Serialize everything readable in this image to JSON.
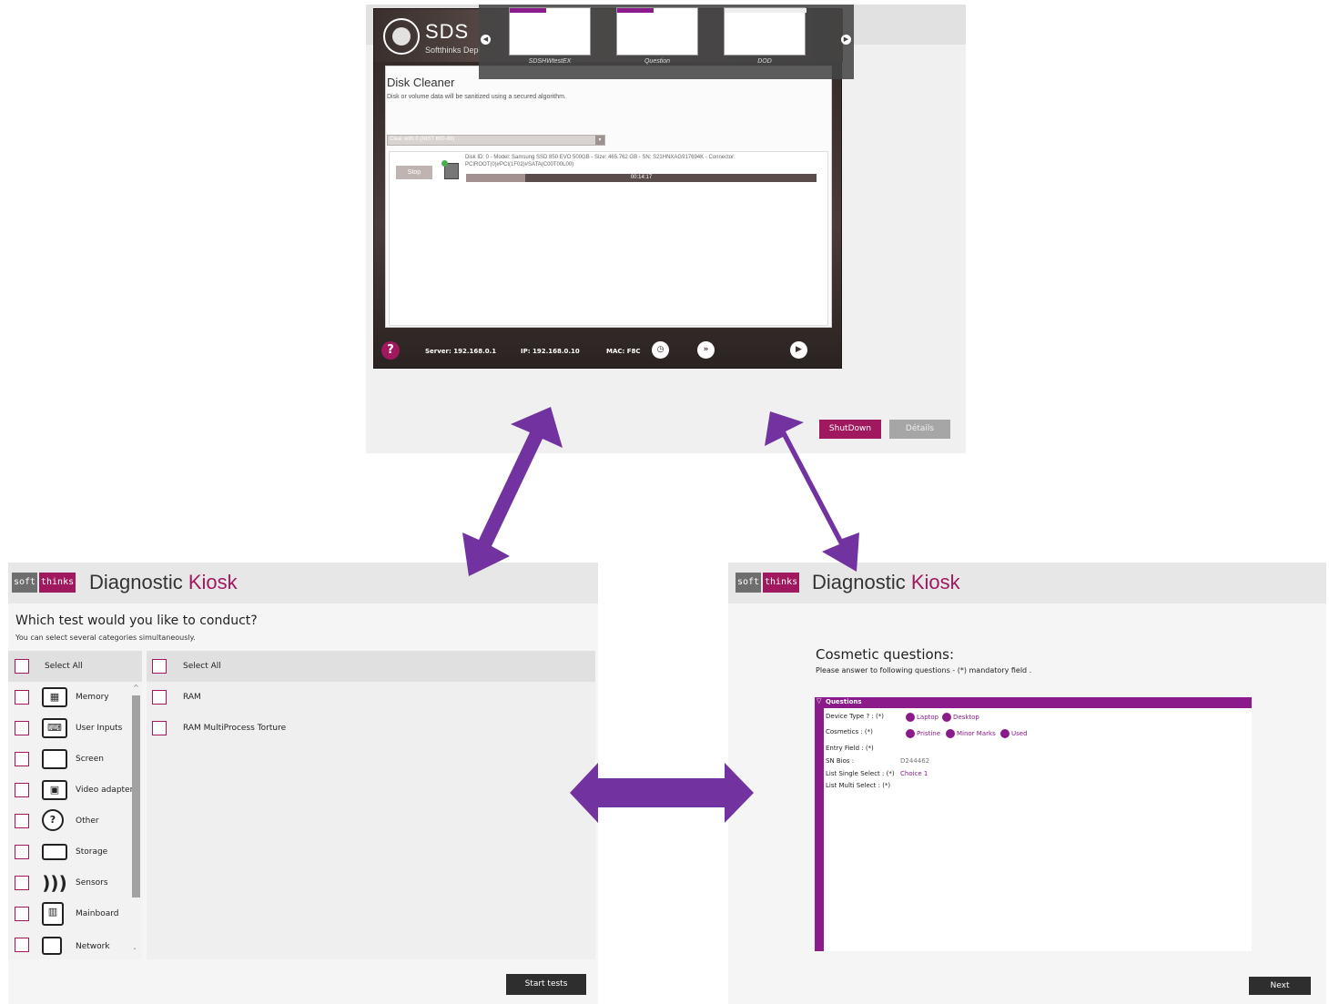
{
  "top_panel": {
    "sds": {
      "title": "SDS",
      "subtitle": "Softthinks Deployment",
      "disk_cleaner_title": "Disk Cleaner",
      "disk_cleaner_subtitle": "Disk or volume data will be sanitized using a secured algorithm.",
      "algorithm_value": "Clear with 0 (NIST 800-88)",
      "stop_label": "Stop",
      "disk_info": "Disk ID: 0 - Model: Samsung SSD 850 EVO 500GB - Size: 465.762 GB - SN: S21HNXAG917694K - Connector: PCIROOT(0)#PCI(1F02)#SATA(C00T00L00)",
      "progress_fraction": 0.17,
      "progress_text": "00:14:17",
      "help_label": "?",
      "server": "Server: 192.168.0.1",
      "ip": "IP: 192.168.0.10",
      "mac": "MAC: F8C"
    },
    "carousel": {
      "items": [
        {
          "label": "SDSHWtestEX"
        },
        {
          "label": "Question"
        },
        {
          "label": "DOD"
        }
      ]
    },
    "buttons": {
      "shutdown": "ShutDown",
      "details": "Détails"
    }
  },
  "left_kiosk": {
    "logo_soft": "soft",
    "logo_thinks": "thinks",
    "title_main": "Diagnostic ",
    "title_accent": "Kiosk",
    "question": "Which test would you like to conduct?",
    "hint": "You can select several categories simultaneously.",
    "categories": [
      {
        "label": "Select All",
        "icon": ""
      },
      {
        "label": "Memory",
        "icon": "memory-icon"
      },
      {
        "label": "User Inputs",
        "icon": "user-inputs-icon"
      },
      {
        "label": "Screen",
        "icon": "screen-icon"
      },
      {
        "label": "Video adapter",
        "icon": "video-adapter-icon"
      },
      {
        "label": "Other",
        "icon": "question-icon"
      },
      {
        "label": "Storage",
        "icon": "storage-icon"
      },
      {
        "label": "Sensors",
        "icon": "sensors-icon"
      },
      {
        "label": "Mainboard",
        "icon": "mainboard-icon"
      },
      {
        "label": "Network",
        "icon": "network-icon"
      }
    ],
    "subtests": [
      {
        "label": "Select All"
      },
      {
        "label": "RAM"
      },
      {
        "label": "RAM MultiProcess Torture"
      }
    ],
    "start_button": "Start tests"
  },
  "right_kiosk": {
    "logo_soft": "soft",
    "logo_thinks": "thinks",
    "title_main": "Diagnostic ",
    "title_accent": "Kiosk",
    "cosmetic_title": "Cosmetic questions:",
    "cosmetic_hint": "Please answer to following questions - (*) mandatory field .",
    "form_header": "Questions",
    "questions": [
      {
        "label": "Device Type ? : (*)",
        "options": [
          "Laptop",
          "Desktop"
        ]
      },
      {
        "label": "Cosmetics : (*)",
        "options": [
          "Pristine",
          "Minor Marks",
          "Used"
        ]
      },
      {
        "label": "Entry Field : (*)",
        "value": ""
      },
      {
        "label": "SN Bios :",
        "value": "D244462"
      },
      {
        "label": "List Single Select : (*)",
        "value": "Choice 1"
      },
      {
        "label": "List Multi Select : (*)",
        "value": ""
      }
    ],
    "next_button": "Next"
  },
  "colors": {
    "accent": "#a0195f",
    "purple": "#8b1a8a",
    "arrow": "#7232a0"
  }
}
